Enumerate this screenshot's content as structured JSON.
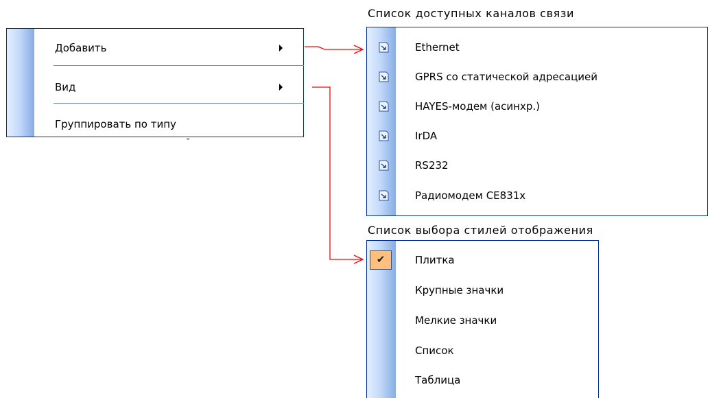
{
  "context_menu": {
    "items": [
      {
        "label": "Добавить",
        "has_submenu": true
      },
      {
        "label": "Вид",
        "has_submenu": true
      },
      {
        "label": "Группировать по типу",
        "has_submenu": false
      }
    ]
  },
  "channels": {
    "caption": "Список доступных каналов связи",
    "items": [
      {
        "label": "Ethernet",
        "icon": "channel-icon"
      },
      {
        "label": "GPRS со статической адресацией",
        "icon": "channel-icon"
      },
      {
        "label": "HAYES-модем (асинхр.)",
        "icon": "channel-icon"
      },
      {
        "label": "IrDA",
        "icon": "channel-icon"
      },
      {
        "label": "RS232",
        "icon": "channel-icon"
      },
      {
        "label": "Радиомодем CE831x",
        "icon": "channel-icon"
      }
    ]
  },
  "view_styles": {
    "caption": "Список выбора стилей отображения",
    "selected": "Плитка",
    "items": [
      {
        "label": "Плитка",
        "checked": true
      },
      {
        "label": "Крупные значки",
        "checked": false
      },
      {
        "label": "Мелкие значки",
        "checked": false
      },
      {
        "label": "Список",
        "checked": false
      },
      {
        "label": "Таблица",
        "checked": false
      }
    ]
  },
  "colors": {
    "menu_border": "#002d96",
    "connector_arrow": "#ff0000",
    "checked_highlight": "#ffc07d"
  }
}
